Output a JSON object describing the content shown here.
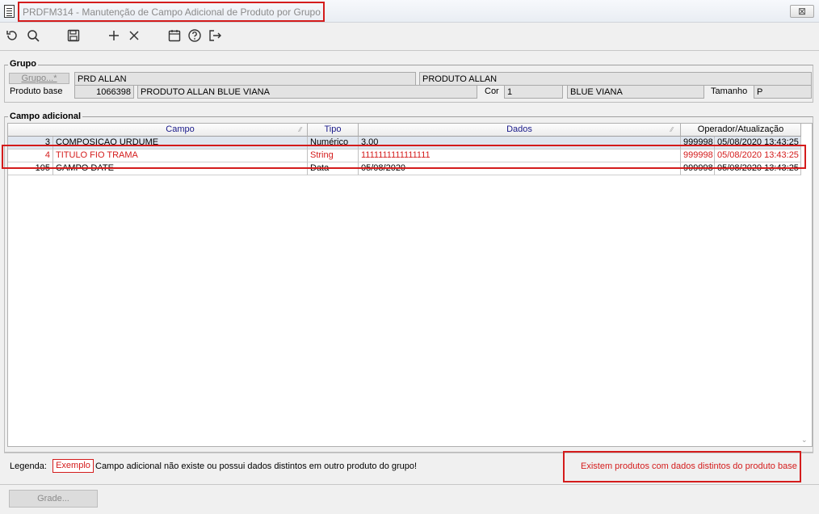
{
  "window": {
    "title": "PRDFM314 - Manutenção de Campo Adicional de Produto por Grupo",
    "close_glyph": "⊠"
  },
  "toolbar": {
    "icons": [
      "refresh-icon",
      "search-icon",
      "save-icon",
      "plus-icon",
      "close-icon",
      "calendar-icon",
      "help-icon",
      "exit-icon"
    ]
  },
  "grupo": {
    "title": "Grupo",
    "button_label": "Grupo...*",
    "code": "PRD ALLAN",
    "name": "PRODUTO ALLAN",
    "produto_base_label": "Produto base",
    "produto_base_code": "1066398",
    "produto_base_name": "PRODUTO ALLAN BLUE VIANA",
    "cor_label": "Cor",
    "cor_code": "1",
    "cor_name": "BLUE VIANA",
    "tamanho_label": "Tamanho",
    "tamanho_value": "P"
  },
  "campo": {
    "title": "Campo adicional",
    "columns": {
      "campo": "Campo",
      "tipo": "Tipo",
      "dados": "Dados",
      "operador": "Operador/Atualização"
    },
    "rows": [
      {
        "id": "3",
        "campo": "COMPOSICAO URDUME",
        "tipo": "Numérico",
        "dados": "3,00",
        "operador": "999998",
        "data": "05/08/2020 13:43:25",
        "distinct": false,
        "selected": true
      },
      {
        "id": "4",
        "campo": "TITULO FIO TRAMA",
        "tipo": "String",
        "dados": "1111111111111111",
        "operador": "999998",
        "data": "05/08/2020 13:43:25",
        "distinct": true,
        "selected": false
      },
      {
        "id": "105",
        "campo": "CAMPO DATE",
        "tipo": "Data",
        "dados": "05/08/2020",
        "operador": "999998",
        "data": "05/08/2020 13:43:25",
        "distinct": false,
        "selected": false
      }
    ]
  },
  "legend": {
    "label": "Legenda:",
    "example": "Exemplo",
    "text": "Campo adicional não existe ou possui dados distintos em outro produto do grupo!",
    "notice": "Existem produtos com dados distintos do produto base"
  },
  "footer": {
    "grade_button": "Grade..."
  },
  "colors": {
    "highlight_red": "#d41c1c",
    "header_text": "#1a1a8a",
    "selected_row": "#dfe6ef"
  }
}
